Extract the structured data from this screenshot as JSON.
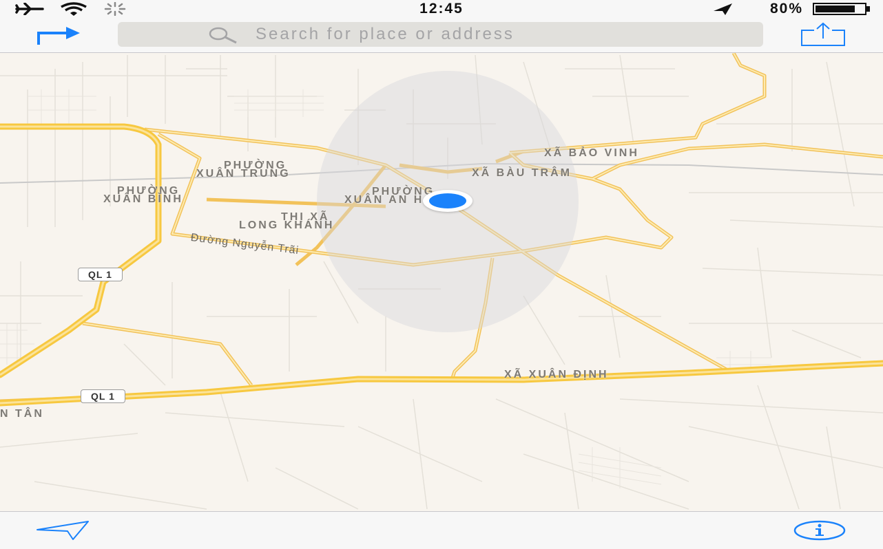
{
  "status_bar": {
    "time": "12:45",
    "battery_percent": "80%",
    "icons": [
      "airplane-icon",
      "wifi-icon",
      "activity-spinner-icon",
      "location-arrow-icon",
      "battery-icon"
    ]
  },
  "nav_bar": {
    "directions_icon": "directions-arrow-icon",
    "search_placeholder": "Search for place or address",
    "search_value": "",
    "share_icon": "share-icon"
  },
  "map": {
    "accent_color": "#1a82fb",
    "road_color": "#f9d35b",
    "labels": {
      "xa_bao_vinh": "XÃ BẢO VINH",
      "xa_bau_tram": "XÃ BÀU TRÂM",
      "phuong_xuan_trung_1": "PHƯỜNG",
      "phuong_xuan_trung_2": "XUÂN TRUNG",
      "phuong_xuan_binh_1": "PHƯỜNG",
      "phuong_xuan_binh_2": "XUÂN BÌNH",
      "phuong_xuan_an_1": "PHƯỜNG",
      "phuong_xuan_an_2": "XUÂN AN H",
      "thi_xa_1": "THỊ XÃ",
      "thi_xa_2": "LONG KHÁNH",
      "street_nguyen_trai": "Đường Nguyễn Trãi",
      "xa_xuan_dinh": "XÃ XUÂN ĐỊNH",
      "tan": "N TÂN"
    },
    "route_shields": [
      "QL 1",
      "QL 1"
    ]
  },
  "toolbar": {
    "location_icon": "location-tracking-icon",
    "info_icon": "info-icon"
  }
}
